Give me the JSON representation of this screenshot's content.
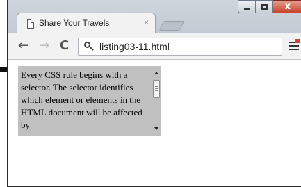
{
  "tab": {
    "title": "Share Your Travels",
    "close_glyph": "×",
    "icon": "page-icon"
  },
  "caption": {
    "close_glyph": "x",
    "close_color": "#c7432b"
  },
  "toolbar": {
    "back_glyph": "←",
    "forward_glyph": "→",
    "reload_glyph": "C",
    "url": "listing03-11.html",
    "search_icon": "search-icon",
    "menu_icon": "hamburger-menu-icon"
  },
  "page": {
    "scrollbox_text": "Every CSS rule begins with a selector. The selector identifies which element or elements in the HTML document will be affected by",
    "scrollbox_bg": "#c0c0c0"
  }
}
